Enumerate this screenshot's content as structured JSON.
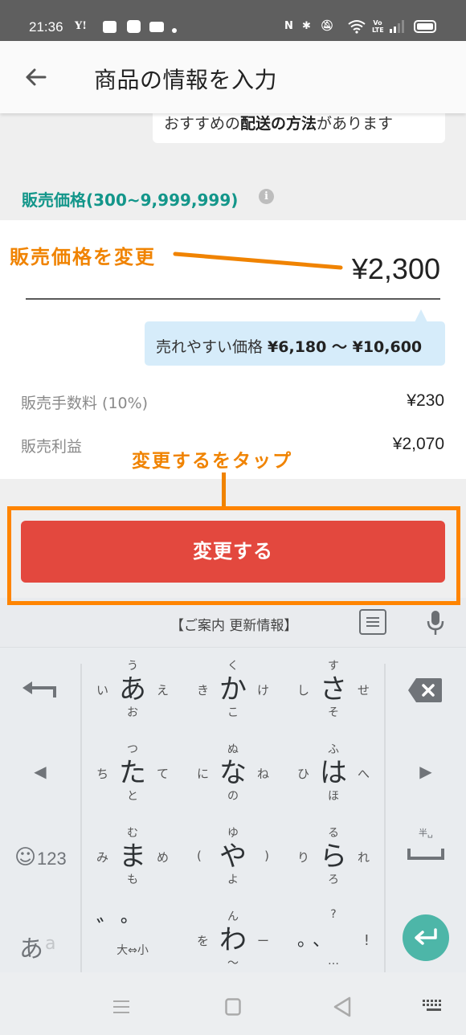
{
  "status_bar": {
    "time": "21:36",
    "left_icons": [
      "yahoo-icon",
      "news-icon",
      "app-notification-icon",
      "youtube-icon",
      "dot-icon"
    ],
    "right_icons": [
      "nfc-icon",
      "bluetooth-icon",
      "mute-icon",
      "wifi-icon",
      "volte-icon",
      "signal-icon",
      "battery-icon"
    ],
    "yahoo_label": "Y!",
    "volte_label": "Vo LTE"
  },
  "app_bar": {
    "back_icon": "arrow-left-icon",
    "title": "商品の情報を入力"
  },
  "shipping_tip": {
    "prefix": "おすすめの",
    "bold": "配送の方法",
    "suffix": "があります"
  },
  "price_section": {
    "label": "販売価格(300~9,999,999)",
    "info_icon": "i",
    "price_value": "¥2,300",
    "suggest_prefix": "売れやすい価格 ",
    "suggest_range": "¥6,180 〜 ¥10,600",
    "fee_label": "販売手数料 (10%)",
    "fee_value": "¥230",
    "profit_label": "販売利益",
    "profit_value": "¥2,070"
  },
  "annotations": {
    "change_price": "販売価格を変更",
    "tap_change": "変更するをタップ",
    "color": "#f08300"
  },
  "change_button": {
    "label": "変更する",
    "color": "#e3483e"
  },
  "keyboard": {
    "topbar_news": "【ご案内 更新情報】",
    "rows": [
      {
        "left": "undo-arrow",
        "keys": [
          {
            "main": "あ",
            "up": "う",
            "down": "お",
            "left": "い",
            "right": "え"
          },
          {
            "main": "か",
            "up": "く",
            "down": "こ",
            "left": "き",
            "right": "け"
          },
          {
            "main": "さ",
            "up": "す",
            "down": "そ",
            "left": "し",
            "right": "せ"
          }
        ],
        "right": "backspace"
      },
      {
        "left": "◀",
        "keys": [
          {
            "main": "た",
            "up": "つ",
            "down": "と",
            "left": "ち",
            "right": "て"
          },
          {
            "main": "な",
            "up": "ぬ",
            "down": "の",
            "left": "に",
            "right": "ね"
          },
          {
            "main": "は",
            "up": "ふ",
            "down": "ほ",
            "left": "ひ",
            "right": "へ"
          }
        ],
        "right": "▶"
      },
      {
        "left": "☺123",
        "keys": [
          {
            "main": "ま",
            "up": "む",
            "down": "も",
            "left": "み",
            "right": "め"
          },
          {
            "main": "や",
            "up": "ゆ",
            "down": "よ",
            "left": "(",
            "right": ")"
          },
          {
            "main": "ら",
            "up": "る",
            "down": "ろ",
            "left": "り",
            "right": "れ"
          }
        ],
        "right": "space"
      },
      {
        "left": "あa",
        "keys": [
          {
            "main": "゛゜",
            "up": "",
            "down": "大⇔小",
            "left": "",
            "right": ""
          },
          {
            "main": "わ",
            "up": "ん",
            "down": "〜",
            "left": "を",
            "right": "ー"
          },
          {
            "main": "。、",
            "up": "?",
            "down": "…",
            "left": "",
            "right": "!"
          }
        ],
        "right": "enter"
      }
    ],
    "space_hint": "半␣",
    "emoji_label": "☺",
    "num_label": "123",
    "kana_label": "あ",
    "alpha_label": "a",
    "enter_color": "#4db6a8"
  },
  "nav_bar": {
    "icons": [
      "recents-icon",
      "home-icon",
      "back-icon",
      "keyboard-hide-icon"
    ]
  }
}
